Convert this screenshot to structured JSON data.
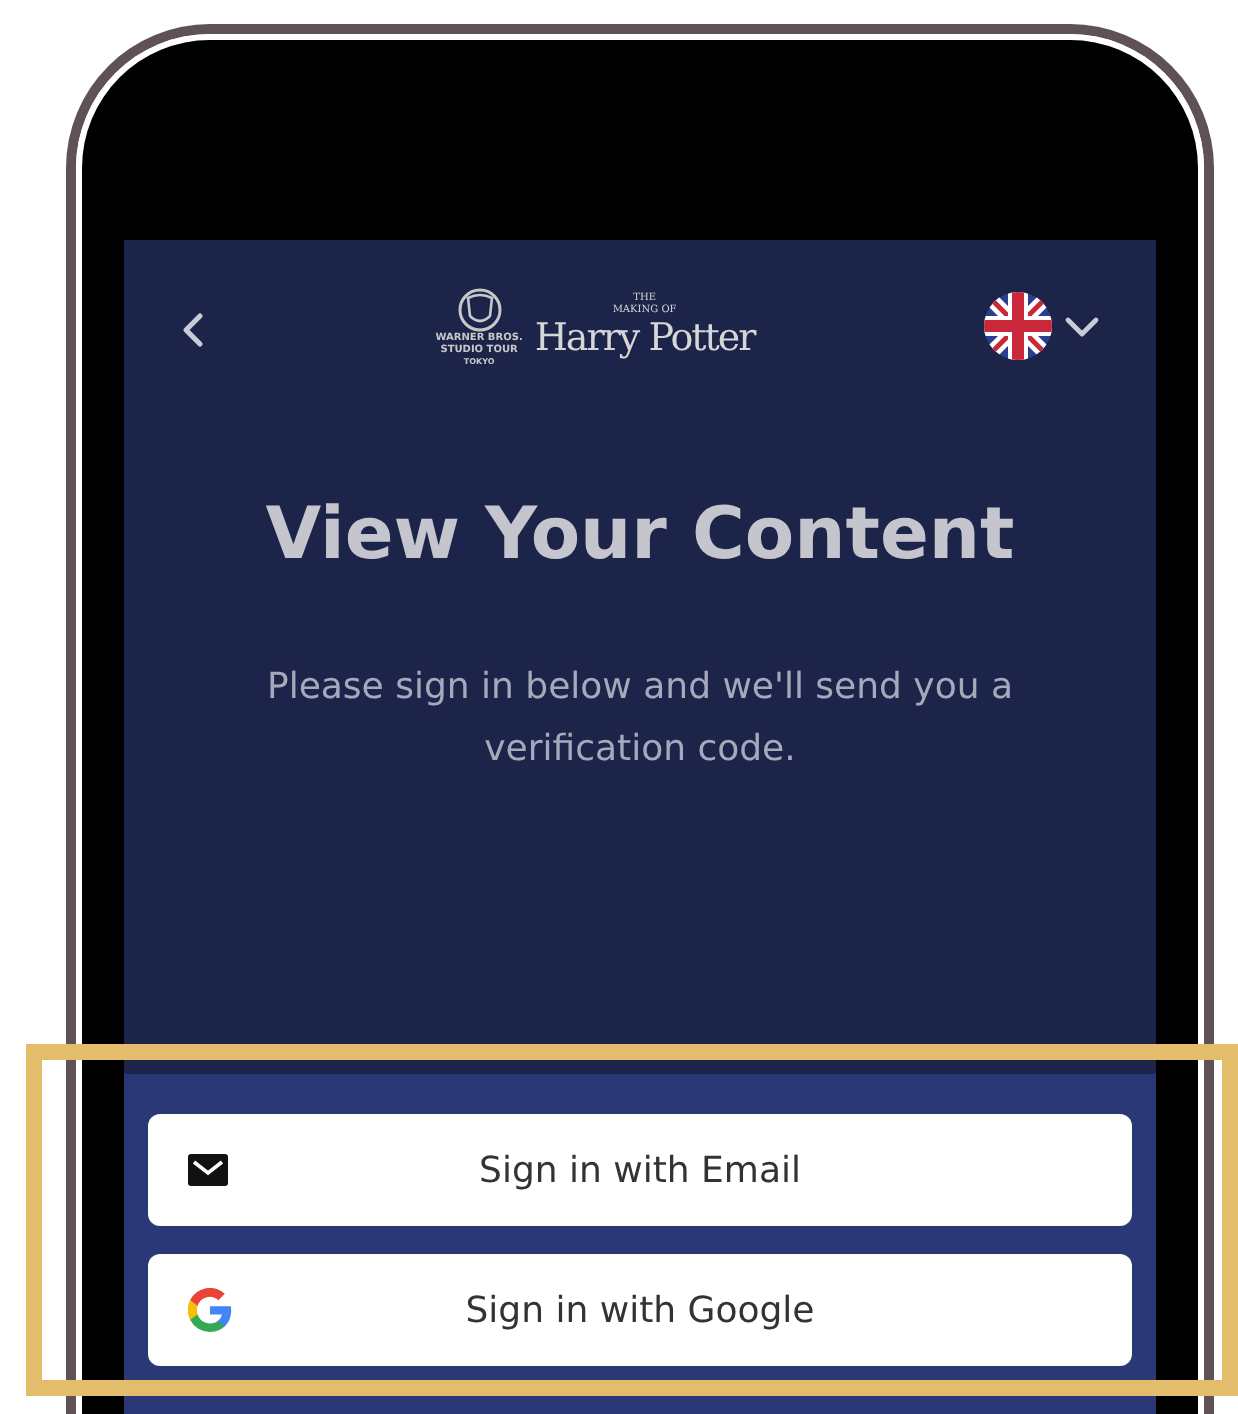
{
  "header": {
    "logo": {
      "studio_lines": [
        "WARNER BROS.",
        "STUDIO TOUR",
        "TOKYO"
      ],
      "kicker_lines": [
        "THE",
        "MAKING OF"
      ],
      "wordmark": "Harry Potter"
    }
  },
  "title": "View Your Content",
  "subtitle": "Please sign in below and we'll send you a verification code.",
  "buttons": [
    {
      "kind": "email",
      "label": "Sign in with Email"
    },
    {
      "kind": "google",
      "label": "Sign in with Google"
    }
  ],
  "highlight": {
    "shown": true
  }
}
